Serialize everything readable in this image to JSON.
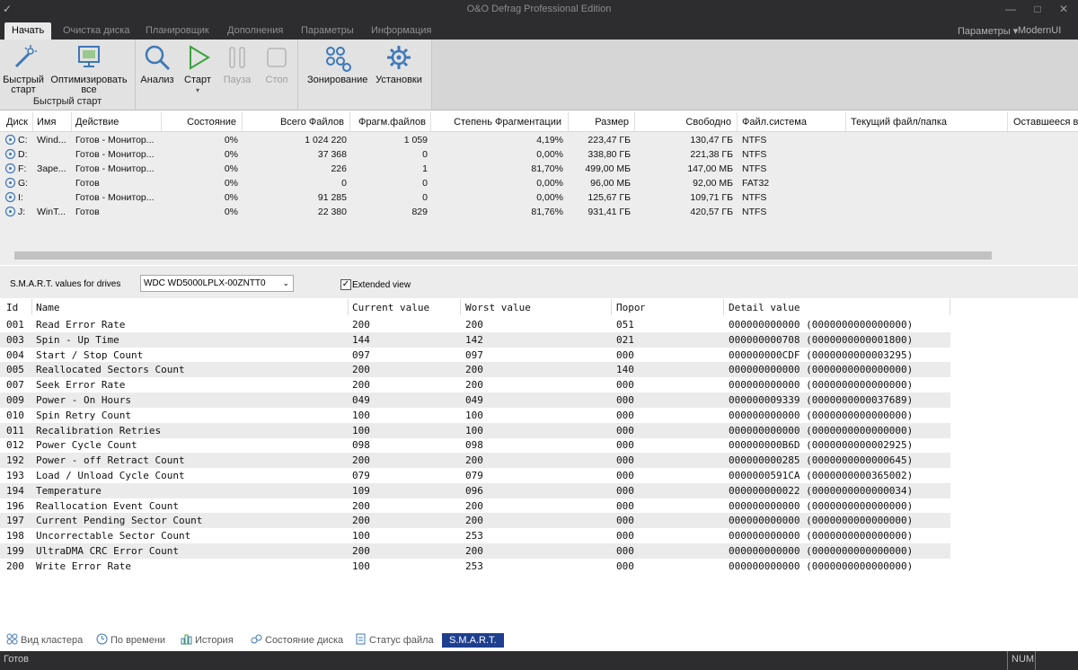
{
  "window": {
    "title": "O&O Defrag Professional Edition",
    "quick_access": "✓"
  },
  "tabs": [
    "Начать",
    "Очистка диска",
    "Планировщик",
    "Дополнения",
    "Параметры",
    "Информация"
  ],
  "tabs_right": {
    "params": "Параметры ▾",
    "modernui": "ModernUI"
  },
  "ribbon": {
    "quick_start": {
      "btn1": [
        "Быстрый",
        "старт"
      ],
      "btn2": [
        "Оптимизировать",
        "все"
      ],
      "group_label": "Быстрый старт"
    },
    "analyze": "Анализ",
    "start": "Старт",
    "pause": "Пауза",
    "stop": "Стоп",
    "zoning": "Зонирование",
    "settings": "Установки"
  },
  "drives": {
    "headers": [
      "Диск",
      "Имя",
      "Действие",
      "Состояние",
      "Всего Файлов",
      "Фрагм.файлов",
      "Степень Фрагментации",
      "Размер",
      "Свободно",
      "Файл.система",
      "Текущий файл/папка",
      "Оставшееся вр"
    ],
    "rows": [
      [
        "C:",
        "Wind...",
        "Готов - Монитор...",
        "0%",
        "1 024 220",
        "1 059",
        "4,19%",
        "223,47 ГБ",
        "130,47 ГБ",
        "NTFS"
      ],
      [
        "D:",
        "",
        "Готов - Монитор...",
        "0%",
        "37 368",
        "0",
        "0,00%",
        "338,80 ГБ",
        "221,38 ГБ",
        "NTFS"
      ],
      [
        "F:",
        "Заре...",
        "Готов - Монитор...",
        "0%",
        "226",
        "1",
        "81,70%",
        "499,00 МБ",
        "147,00 МБ",
        "NTFS"
      ],
      [
        "G:",
        "",
        "Готов",
        "0%",
        "0",
        "0",
        "0,00%",
        "96,00 МБ",
        "92,00 МБ",
        "FAT32"
      ],
      [
        "I:",
        "",
        "Готов - Монитор...",
        "0%",
        "91 285",
        "0",
        "0,00%",
        "125,67 ГБ",
        "109,71 ГБ",
        "NTFS"
      ],
      [
        "J:",
        "WinT...",
        "Готов",
        "0%",
        "22 380",
        "829",
        "81,76%",
        "931,41 ГБ",
        "420,57 ГБ",
        "NTFS"
      ]
    ]
  },
  "smart_bar": {
    "label": "S.M.A.R.T. values for drives",
    "drive": "WDC WD5000LPLX-00ZNTT0",
    "extended_label": "Extended view",
    "extended_checked": true
  },
  "smart": {
    "headers": [
      "Id",
      "Name",
      "Current value",
      "Worst value",
      "Порог",
      "Detail value"
    ],
    "rows": [
      [
        "001",
        "Read Error Rate",
        "200",
        "200",
        "051",
        "000000000000 (0000000000000000)"
      ],
      [
        "003",
        "Spin - Up Time",
        "144",
        "142",
        "021",
        "000000000708 (0000000000001800)"
      ],
      [
        "004",
        "Start / Stop Count",
        "097",
        "097",
        "000",
        "000000000CDF (0000000000003295)"
      ],
      [
        "005",
        "Reallocated Sectors Count",
        "200",
        "200",
        "140",
        "000000000000 (0000000000000000)"
      ],
      [
        "007",
        "Seek Error Rate",
        "200",
        "200",
        "000",
        "000000000000 (0000000000000000)"
      ],
      [
        "009",
        "Power - On Hours",
        "049",
        "049",
        "000",
        "000000009339 (0000000000037689)"
      ],
      [
        "010",
        "Spin Retry Count",
        "100",
        "100",
        "000",
        "000000000000 (0000000000000000)"
      ],
      [
        "011",
        "Recalibration Retries",
        "100",
        "100",
        "000",
        "000000000000 (0000000000000000)"
      ],
      [
        "012",
        "Power Cycle Count",
        "098",
        "098",
        "000",
        "000000000B6D (0000000000002925)"
      ],
      [
        "192",
        "Power - off Retract Count",
        "200",
        "200",
        "000",
        "000000000285 (0000000000000645)"
      ],
      [
        "193",
        "Load / Unload Cycle Count",
        "079",
        "079",
        "000",
        "0000000591CA (0000000000365002)"
      ],
      [
        "194",
        "Temperature",
        "109",
        "096",
        "000",
        "000000000022 (0000000000000034)"
      ],
      [
        "196",
        "Reallocation Event Count",
        "200",
        "200",
        "000",
        "000000000000 (0000000000000000)"
      ],
      [
        "197",
        "Current Pending Sector Count",
        "200",
        "200",
        "000",
        "000000000000 (0000000000000000)"
      ],
      [
        "198",
        "Uncorrectable Sector Count",
        "100",
        "253",
        "000",
        "000000000000 (0000000000000000)"
      ],
      [
        "199",
        "UltraDMA CRC Error Count",
        "200",
        "200",
        "000",
        "000000000000 (0000000000000000)"
      ],
      [
        "200",
        "Write Error Rate",
        "100",
        "253",
        "000",
        "000000000000 (0000000000000000)"
      ]
    ]
  },
  "bottom_tabs": [
    "Вид кластера",
    "По времени",
    "История",
    "Состояние диска",
    "Статус файла",
    "S.M.A.R.T."
  ],
  "status": {
    "text": "Готов",
    "num": "NUM"
  },
  "colors": {
    "chrome": "#2d2d30",
    "ribbon": "#e2e2e2",
    "accent": "#1e3f8f",
    "icon_blue": "#3e78b8",
    "icon_green": "#3aa33a"
  }
}
